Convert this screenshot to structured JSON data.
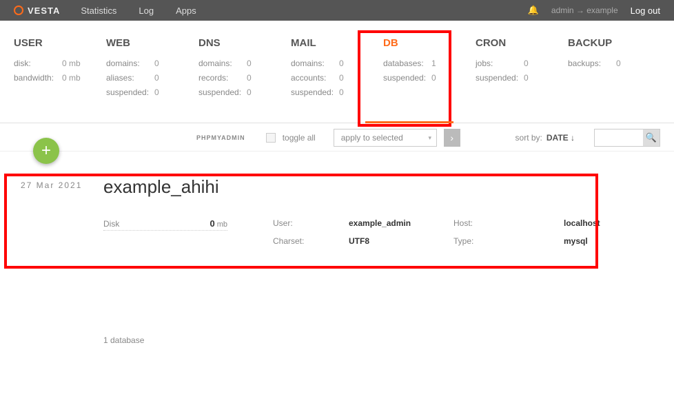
{
  "topbar": {
    "brand": "VESTA",
    "nav": {
      "statistics": "Statistics",
      "log": "Log",
      "apps": "Apps"
    },
    "user_path": "admin → example",
    "logout": "Log out"
  },
  "panel": {
    "user": {
      "title": "USER",
      "rows": [
        {
          "l": "disk:",
          "v": "0 mb"
        },
        {
          "l": "bandwidth:",
          "v": "0 mb"
        }
      ]
    },
    "web": {
      "title": "WEB",
      "rows": [
        {
          "l": "domains:",
          "v": "0"
        },
        {
          "l": "aliases:",
          "v": "0"
        },
        {
          "l": "suspended:",
          "v": "0"
        }
      ]
    },
    "dns": {
      "title": "DNS",
      "rows": [
        {
          "l": "domains:",
          "v": "0"
        },
        {
          "l": "records:",
          "v": "0"
        },
        {
          "l": "suspended:",
          "v": "0"
        }
      ]
    },
    "mail": {
      "title": "MAIL",
      "rows": [
        {
          "l": "domains:",
          "v": "0"
        },
        {
          "l": "accounts:",
          "v": "0"
        },
        {
          "l": "suspended:",
          "v": "0"
        }
      ]
    },
    "db": {
      "title": "DB",
      "rows": [
        {
          "l": "databases:",
          "v": "1"
        },
        {
          "l": "suspended:",
          "v": "0"
        }
      ]
    },
    "cron": {
      "title": "CRON",
      "rows": [
        {
          "l": "jobs:",
          "v": "0"
        },
        {
          "l": "suspended:",
          "v": "0"
        }
      ]
    },
    "backup": {
      "title": "BACKUP",
      "rows": [
        {
          "l": "backups:",
          "v": "0"
        }
      ]
    }
  },
  "toolbar": {
    "phpmyadmin": "PHPMYADMIN",
    "toggle_all": "toggle all",
    "apply": "apply to selected",
    "sort_label": "sort by:",
    "sort_value": "DATE ↓"
  },
  "item": {
    "date": "27 Mar 2021",
    "name": "example_ahihi",
    "disk_label": "Disk",
    "disk_value": "0",
    "disk_unit": "mb",
    "user_label": "User:",
    "user_value": "example_admin",
    "charset_label": "Charset:",
    "charset_value": "UTF8",
    "host_label": "Host:",
    "host_value": "localhost",
    "type_label": "Type:",
    "type_value": "mysql"
  },
  "footer": {
    "count": "1 database"
  }
}
